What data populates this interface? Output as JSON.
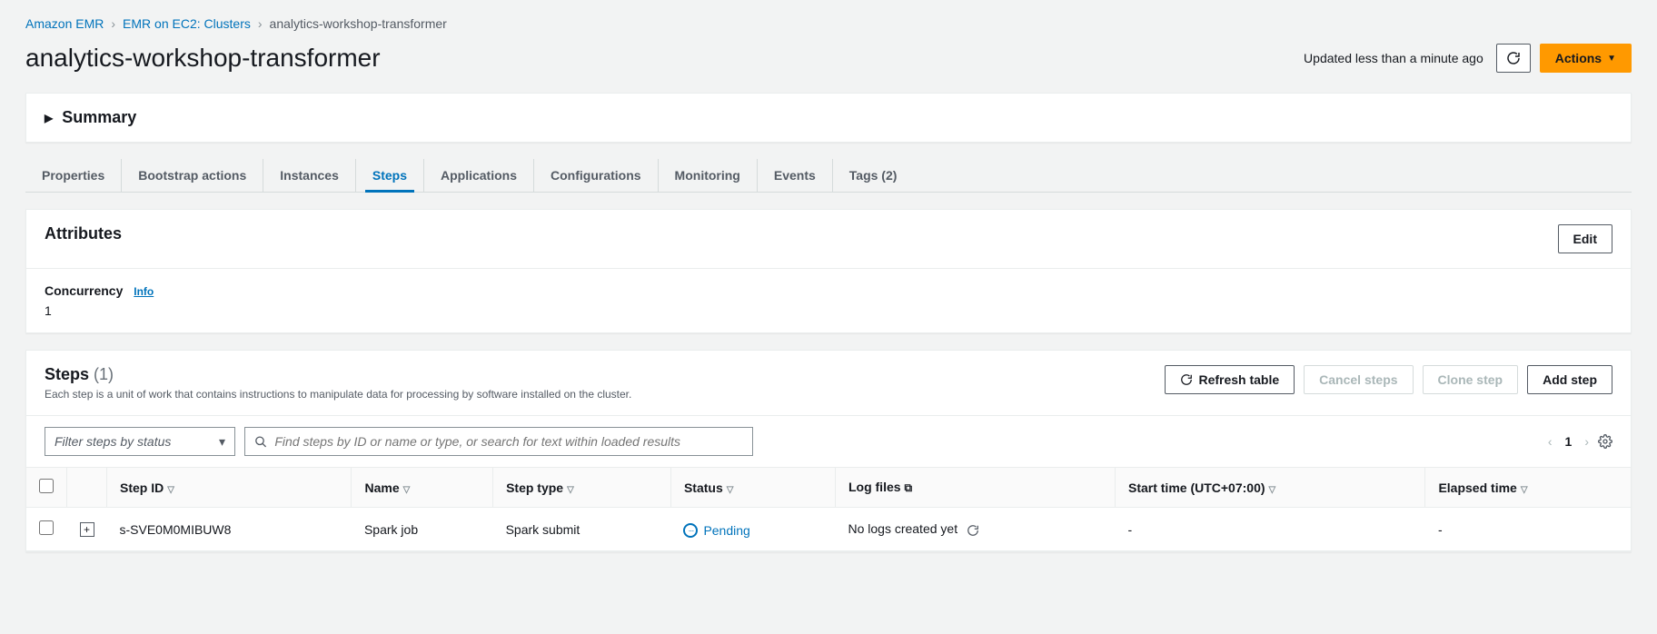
{
  "breadcrumb": {
    "root": "Amazon EMR",
    "mid": "EMR on EC2: Clusters",
    "current": "analytics-workshop-transformer"
  },
  "header": {
    "title": "analytics-workshop-transformer",
    "updated": "Updated less than a minute ago",
    "actions_label": "Actions"
  },
  "summary": {
    "title": "Summary"
  },
  "tabs": {
    "properties": "Properties",
    "bootstrap": "Bootstrap actions",
    "instances": "Instances",
    "steps": "Steps",
    "applications": "Applications",
    "configurations": "Configurations",
    "monitoring": "Monitoring",
    "events": "Events",
    "tags": "Tags (2)"
  },
  "attributes": {
    "title": "Attributes",
    "edit": "Edit",
    "concurrency_label": "Concurrency",
    "info": "Info",
    "concurrency_value": "1"
  },
  "steps": {
    "title": "Steps",
    "count": "(1)",
    "subtitle": "Each step is a unit of work that contains instructions to manipulate data for processing by software installed on the cluster.",
    "refresh": "Refresh table",
    "cancel": "Cancel steps",
    "clone": "Clone step",
    "add": "Add step",
    "filter_placeholder": "Filter steps by status",
    "search_placeholder": "Find steps by ID or name or type, or search for text within loaded results",
    "page": "1",
    "columns": {
      "step_id": "Step ID",
      "name": "Name",
      "type": "Step type",
      "status": "Status",
      "logs": "Log files",
      "start": "Start time (UTC+07:00)",
      "elapsed": "Elapsed time"
    },
    "rows": [
      {
        "id": "s-SVE0M0MIBUW8",
        "name": "Spark job",
        "type": "Spark submit",
        "status": "Pending",
        "logs": "No logs created yet",
        "start": "-",
        "elapsed": "-"
      }
    ]
  }
}
